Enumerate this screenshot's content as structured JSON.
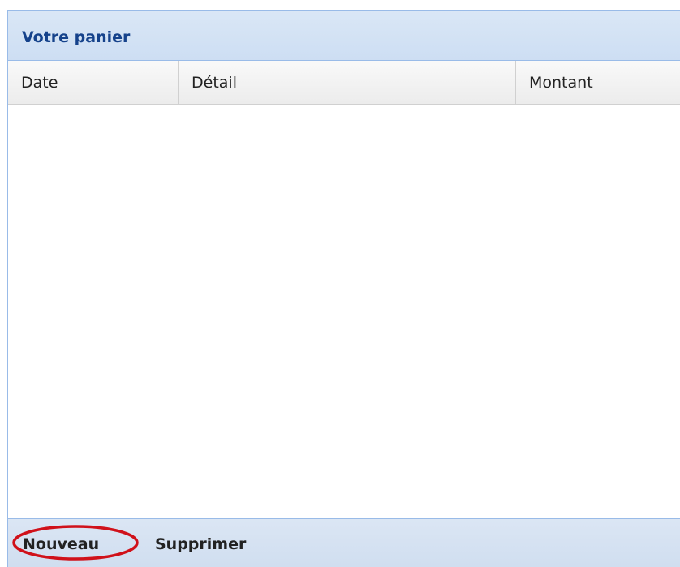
{
  "panel": {
    "title": "Votre panier"
  },
  "grid": {
    "columns": [
      {
        "label": "Date"
      },
      {
        "label": "Détail"
      },
      {
        "label": "Montant"
      }
    ],
    "rows": []
  },
  "toolbar": {
    "new_label": "Nouveau",
    "delete_label": "Supprimer"
  },
  "annotation": {
    "highlight_color": "#d0111a"
  },
  "colors": {
    "title": "#15428b",
    "border": "#99bbe8"
  }
}
